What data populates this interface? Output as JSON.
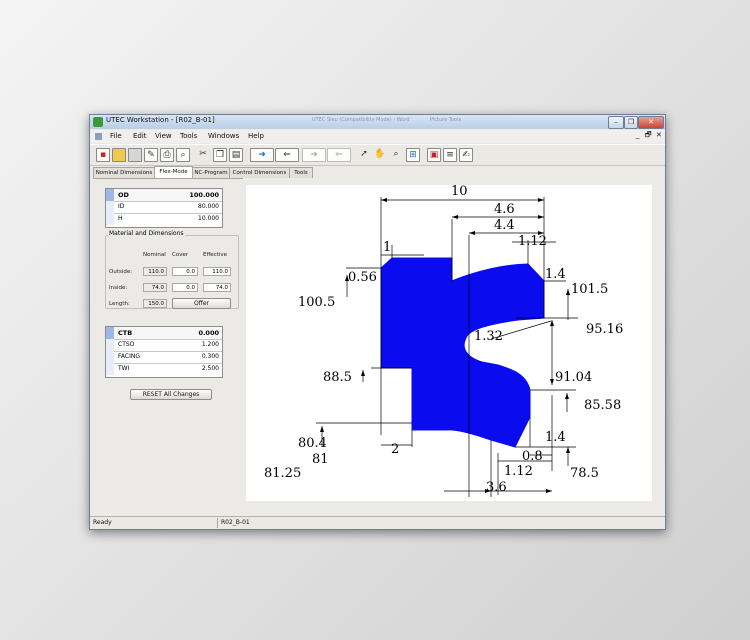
{
  "window": {
    "title": "UTEC Workstation - [R02_B-01]",
    "title_ghost_1": "UTEC Sieu (Compatibility Mode) - Word",
    "title_ghost_2": "Picture Tools",
    "minimize": "–",
    "restore": "❐",
    "close": "✕"
  },
  "menu": {
    "items": [
      "File",
      "Edit",
      "View",
      "Tools",
      "Windows",
      "Help"
    ],
    "mdi_minimize": "_",
    "mdi_restore": "🗗",
    "mdi_close": "✕"
  },
  "toolbar": {
    "icons": [
      "new-icon",
      "open-icon",
      "save-icon",
      "edit-icon",
      "print-icon",
      "find-icon",
      "cut-icon",
      "copy-icon",
      "paste-icon",
      "export-icon",
      "import-icon",
      "disabled-icon-1",
      "disabled-icon-2",
      "pointer-icon",
      "hand-icon",
      "zoom-icon",
      "zoom-fit-icon",
      "pdf-icon",
      "report-icon",
      "notes-icon"
    ]
  },
  "tabs": [
    "Nominal Dimensions",
    "Flex-Mode",
    "NC-Program",
    "Control Dimensions",
    "Tools"
  ],
  "active_tab": 1,
  "dims_grid": {
    "rows": [
      {
        "label": "OD",
        "value": "100.000"
      },
      {
        "label": "ID",
        "value": "80.000"
      },
      {
        "label": "H",
        "value": "10.000"
      }
    ]
  },
  "material": {
    "title": "Material and Dimensions",
    "col_nominal": "Nominal",
    "col_cover": "Cover",
    "col_effective": "Effective",
    "rows": [
      {
        "label": "Outside:",
        "nominal": "110.0",
        "cover": "0.0",
        "effective": "110.0"
      },
      {
        "label": "Inside:",
        "nominal": "74.0",
        "cover": "0.0",
        "effective": "74.0"
      },
      {
        "label": "Length:",
        "nominal": "150.0"
      }
    ],
    "offer_label": "Offer"
  },
  "params_grid": {
    "rows": [
      {
        "label": "CTB",
        "value": "0.000"
      },
      {
        "label": "CTSO",
        "value": "1.200"
      },
      {
        "label": "FACING",
        "value": "0.300"
      },
      {
        "label": "TWI",
        "value": "2.500"
      }
    ]
  },
  "reset_label": "RESET All Changes",
  "drawing": {
    "labels": {
      "d10": "10",
      "d4_6": "4.6",
      "d4_4": "4.4",
      "d1": "1",
      "d1_12a": "1.12",
      "d0_56": "0.56",
      "d1_4a": "1.4",
      "d101_5": "101.5",
      "d100_5": "100.5",
      "d95_16": "95.16",
      "d1_32": "1.32",
      "d88_5": "88.5",
      "d91_04": "91.04",
      "d85_58": "85.58",
      "d80_4": "80.4",
      "d2": "2",
      "d1_4b": "1.4",
      "d81": "81",
      "d0_8": "0.8",
      "d1_12b": "1.12",
      "d78_5": "78.5",
      "d81_25": "81.25",
      "d3_6": "3.6"
    },
    "fill_color": "#0b0bf0"
  },
  "status": {
    "ready": "Ready",
    "file": "R02_B-01"
  }
}
